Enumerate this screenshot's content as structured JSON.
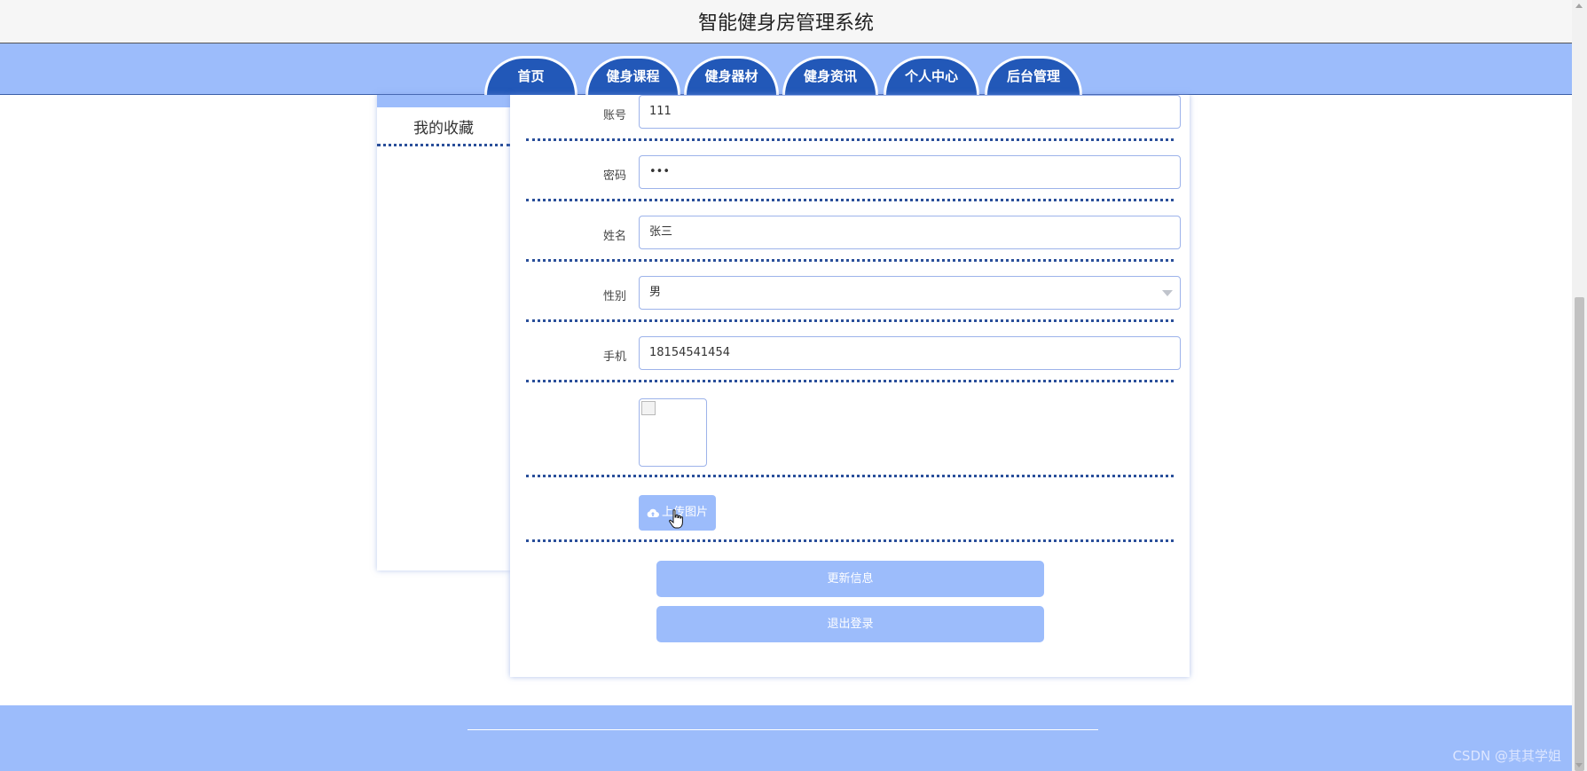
{
  "header": {
    "title": "智能健身房管理系统"
  },
  "nav": {
    "items": [
      {
        "label": "首页"
      },
      {
        "label": "健身课程"
      },
      {
        "label": "健身器材"
      },
      {
        "label": "健身资讯"
      },
      {
        "label": "个人中心"
      },
      {
        "label": "后台管理"
      }
    ]
  },
  "sidebar": {
    "items": [
      {
        "label": "我的收藏"
      }
    ]
  },
  "form": {
    "account": {
      "label": "账号",
      "value": "111"
    },
    "password": {
      "label": "密码",
      "value": "•••"
    },
    "name": {
      "label": "姓名",
      "value": "张三"
    },
    "gender": {
      "label": "性别",
      "value": "男"
    },
    "phone": {
      "label": "手机",
      "value": "18154541454"
    },
    "upload_label": "上传图片",
    "update_label": "更新信息",
    "logout_label": "退出登录"
  },
  "footer": {
    "watermark": "CSDN @其其学姐"
  },
  "colors": {
    "nav_bg": "#9cbcfb",
    "nav_item": "#2258b8",
    "border_dotted": "#2a4f9a",
    "button": "#9cbcfb"
  }
}
